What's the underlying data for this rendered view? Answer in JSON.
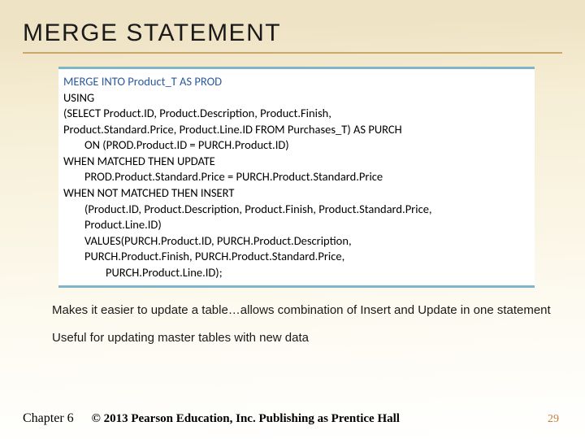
{
  "title": "MERGE STATEMENT",
  "code": {
    "l1a": "MERGE INTO Product_T AS PROD",
    "l2": "USING",
    "l3": "(SELECT Product.ID, Product.Description, Product.Finish,",
    "l4": "Product.Standard.Price, Product.Line.ID FROM Purchases_T) AS PURCH",
    "l5": "ON (PROD.Product.ID = PURCH.Product.ID)",
    "l6": "WHEN MATCHED THEN UPDATE",
    "l7": "PROD.Product.Standard.Price = PURCH.Product.Standard.Price",
    "l8": "WHEN NOT MATCHED THEN INSERT",
    "l9": "(Product.ID, Product.Description, Product.Finish, Product.Standard.Price,",
    "l10": "Product.Line.ID)",
    "l11": "VALUES(PURCH.Product.ID, PURCH.Product.Description,",
    "l12": "PURCH.Product.Finish, PURCH.Product.Standard.Price,",
    "l13": "PURCH.Product.Line.ID);"
  },
  "bullets": {
    "b1": "Makes it easier to update a table…allows combination of Insert and Update in one statement",
    "b2": "Useful for updating master tables with new data"
  },
  "footer": {
    "chapter": "Chapter 6",
    "copyright": "© 2013 Pearson Education, Inc.  Publishing as Prentice Hall",
    "page": "29"
  }
}
